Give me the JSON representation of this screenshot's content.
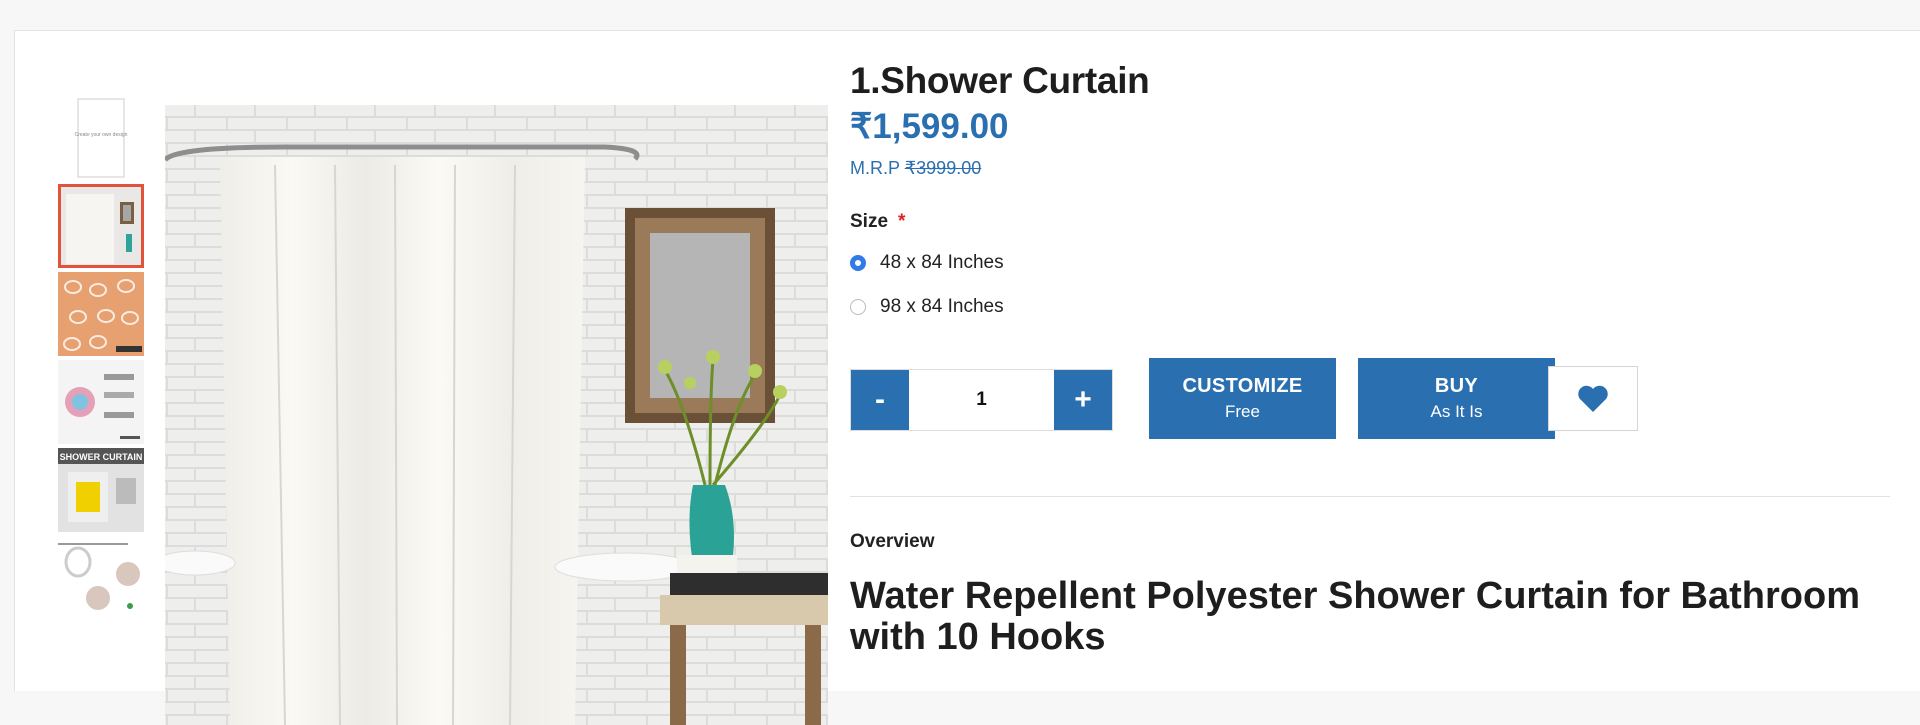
{
  "product": {
    "title": "1.Shower Curtain",
    "price": "₹1,599.00",
    "mrp_label": "M.R.P",
    "mrp_value": "₹3999.00"
  },
  "size": {
    "label": "Size",
    "required_mark": "*",
    "options": [
      {
        "label": "48 x 84 Inches",
        "selected": true
      },
      {
        "label": "98 x 84 Inches",
        "selected": false
      }
    ]
  },
  "quantity": {
    "minus": "-",
    "value": "1",
    "plus": "+"
  },
  "buttons": {
    "customize_line1": "CUSTOMIZE",
    "customize_line2": "Free",
    "buy_line1": "BUY",
    "buy_line2": "As It Is",
    "wishlist_icon": "heart-icon"
  },
  "overview": {
    "label": "Overview",
    "heading": "Water Repellent Polyester Shower Curtain for Bathroom with 10 Hooks"
  },
  "gallery": {
    "thumbnails": [
      "template-thumb",
      "curtain-thumb",
      "hooks-thumb",
      "features-thumb",
      "shower-curtain-thumb",
      "hook-closeup-thumb"
    ],
    "active_index": 1,
    "thumb_text_banner": "SHOWER CURTAIN",
    "thumb_text_template": "Create your own design"
  },
  "colors": {
    "accent": "#2a6fb0",
    "active_thumb_border": "#e2533c",
    "required": "#dd2222"
  }
}
